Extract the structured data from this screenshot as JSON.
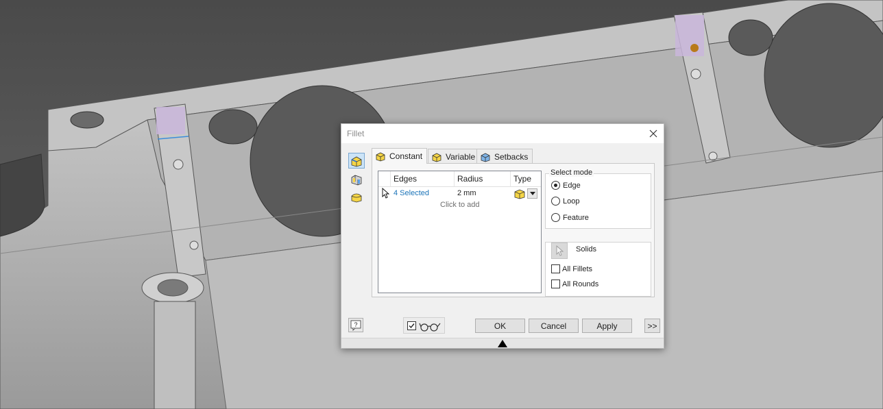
{
  "dialog": {
    "title": "Fillet",
    "tabs": [
      {
        "label": "Constant",
        "icon": "fillet-constant-icon",
        "active": true
      },
      {
        "label": "Variable",
        "icon": "fillet-variable-icon",
        "active": false
      },
      {
        "label": "Setbacks",
        "icon": "fillet-setbacks-icon",
        "active": false
      }
    ],
    "grid": {
      "headers": [
        "Edges",
        "Radius",
        "Type"
      ],
      "rows": [
        {
          "edges": "4 Selected",
          "radius": "2 mm",
          "type_icon": "edge-fillet-type-icon"
        }
      ],
      "add_hint": "Click to add"
    },
    "select_mode": {
      "label": "Select mode",
      "options": [
        "Edge",
        "Loop",
        "Feature"
      ],
      "selected": "Edge"
    },
    "solids": {
      "label": "Solids",
      "options": [
        "All Fillets",
        "All Rounds"
      ]
    },
    "buttons": {
      "ok": "OK",
      "cancel": "Cancel",
      "apply": "Apply",
      "more": ">>"
    },
    "preview_checked": true
  },
  "colors": {
    "link": "#1a73b8",
    "accent": "#cce4f7",
    "background_model": "#c9c9c9"
  }
}
